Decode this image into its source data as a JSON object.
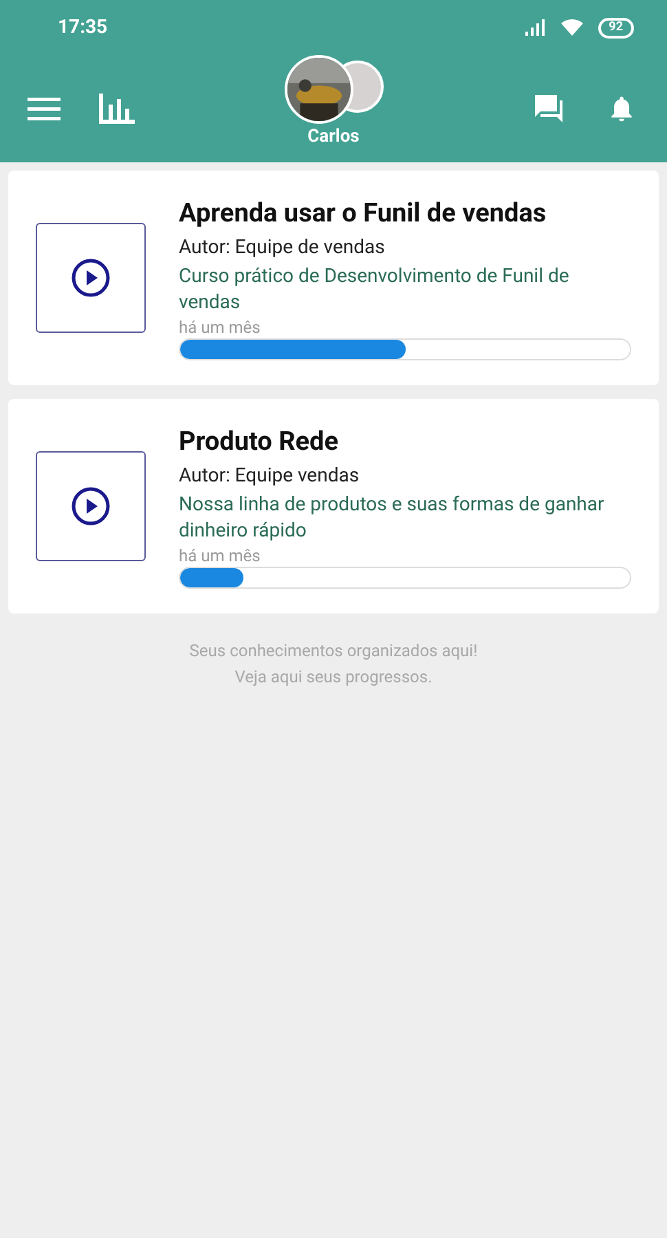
{
  "status_bar": {
    "time": "17:35",
    "battery": "92"
  },
  "toolbar": {
    "user_name": "Carlos"
  },
  "courses": [
    {
      "title": "Aprenda usar o Funil de vendas",
      "author": "Autor: Equipe de vendas",
      "description": "Curso prático de Desenvolvimento de Funil de vendas",
      "date": "há um mês",
      "level": 0.5
    },
    {
      "title": "Produto Rede",
      "author": "Autor: Equipe vendas",
      "description": "Nossa linha de produtos e suas formas de ganhar dinheiro rápido",
      "date": "há um mês",
      "level": 0.14
    }
  ],
  "footer": [
    "Seus conhecimentos organizados aqui!",
    "Veja aqui seus progressos."
  ]
}
